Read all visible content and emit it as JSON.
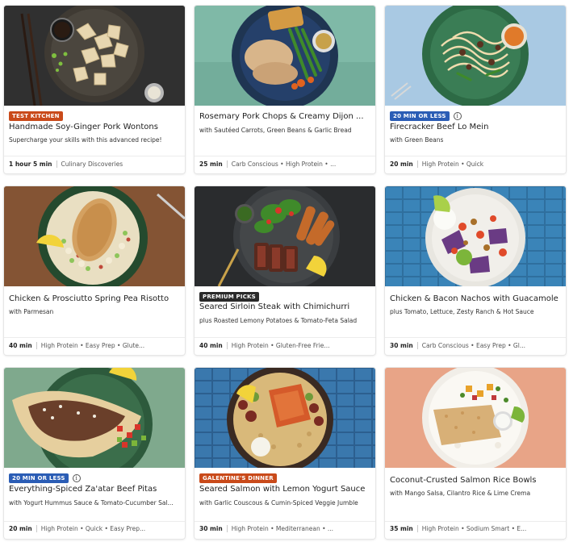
{
  "recipes": [
    {
      "badge": "TEST KITCHEN",
      "badge_color": "#c94a1a",
      "info_icon": false,
      "title": "Handmade Soy-Ginger Pork Wontons",
      "subtitle": "Supercharge your skills with this advanced recipe!",
      "time": "1 hour 5 min",
      "tags": "Culinary Discoveries",
      "image_theme": "dark-wontons"
    },
    {
      "badge": "",
      "badge_color": "",
      "info_icon": false,
      "title": "Rosemary Pork Chops & Creamy Dijon ...",
      "subtitle": "with Sautéed Carrots, Green Beans & Garlic Bread",
      "time": "25 min",
      "tags": "Carb Conscious • High Protein • ...",
      "image_theme": "teal-porkchop"
    },
    {
      "badge": "20 MIN OR LESS",
      "badge_color": "#2b5db5",
      "info_icon": true,
      "title": "Firecracker Beef Lo Mein",
      "subtitle": "with Green Beans",
      "time": "20 min",
      "tags": "High Protein • Quick",
      "image_theme": "blue-lomein"
    },
    {
      "badge": "",
      "badge_color": "",
      "info_icon": false,
      "title": "Chicken & Prosciutto Spring Pea Risotto",
      "subtitle": "with Parmesan",
      "time": "40 min",
      "tags": "High Protein • Easy Prep • Glute...",
      "image_theme": "wood-risotto"
    },
    {
      "badge": "PREMIUM PICKS",
      "badge_color": "#2a2a2a",
      "info_icon": false,
      "title": "Seared Sirloin Steak with Chimichurri",
      "subtitle": "plus Roasted Lemony Potatoes & Tomato-Feta Salad",
      "time": "40 min",
      "tags": "High Protein • Gluten-Free Frie...",
      "image_theme": "dark-steak"
    },
    {
      "badge": "",
      "badge_color": "",
      "info_icon": false,
      "title": "Chicken & Bacon Nachos with Guacamole",
      "subtitle": "plus Tomato, Lettuce, Zesty Ranch & Hot Sauce",
      "time": "30 min",
      "tags": "Carb Conscious • Easy Prep • Gl...",
      "image_theme": "tile-nachos"
    },
    {
      "badge": "20 MIN OR LESS",
      "badge_color": "#2b5db5",
      "info_icon": true,
      "title": "Everything-Spiced Za'atar Beef Pitas",
      "subtitle": "with Yogurt Hummus Sauce & Tomato-Cucumber Sal...",
      "time": "20 min",
      "tags": "High Protein • Quick • Easy Prep...",
      "image_theme": "green-pitas"
    },
    {
      "badge": "GALENTINE'S DINNER",
      "badge_color": "#c94a1a",
      "info_icon": false,
      "title": "Seared Salmon with Lemon Yogurt Sauce",
      "subtitle": "with Garlic Couscous & Cumin-Spiced Veggie Jumble",
      "time": "30 min",
      "tags": "High Protein • Mediterranean • ...",
      "image_theme": "tile-salmon"
    },
    {
      "badge": "",
      "badge_color": "",
      "info_icon": false,
      "title": "Coconut-Crusted Salmon Rice Bowls",
      "subtitle": "with Mango Salsa, Cilantro Rice & Lime Crema",
      "time": "35 min",
      "tags": "High Protein • Sodium Smart • E...",
      "image_theme": "peach-salmon-bowl"
    }
  ]
}
